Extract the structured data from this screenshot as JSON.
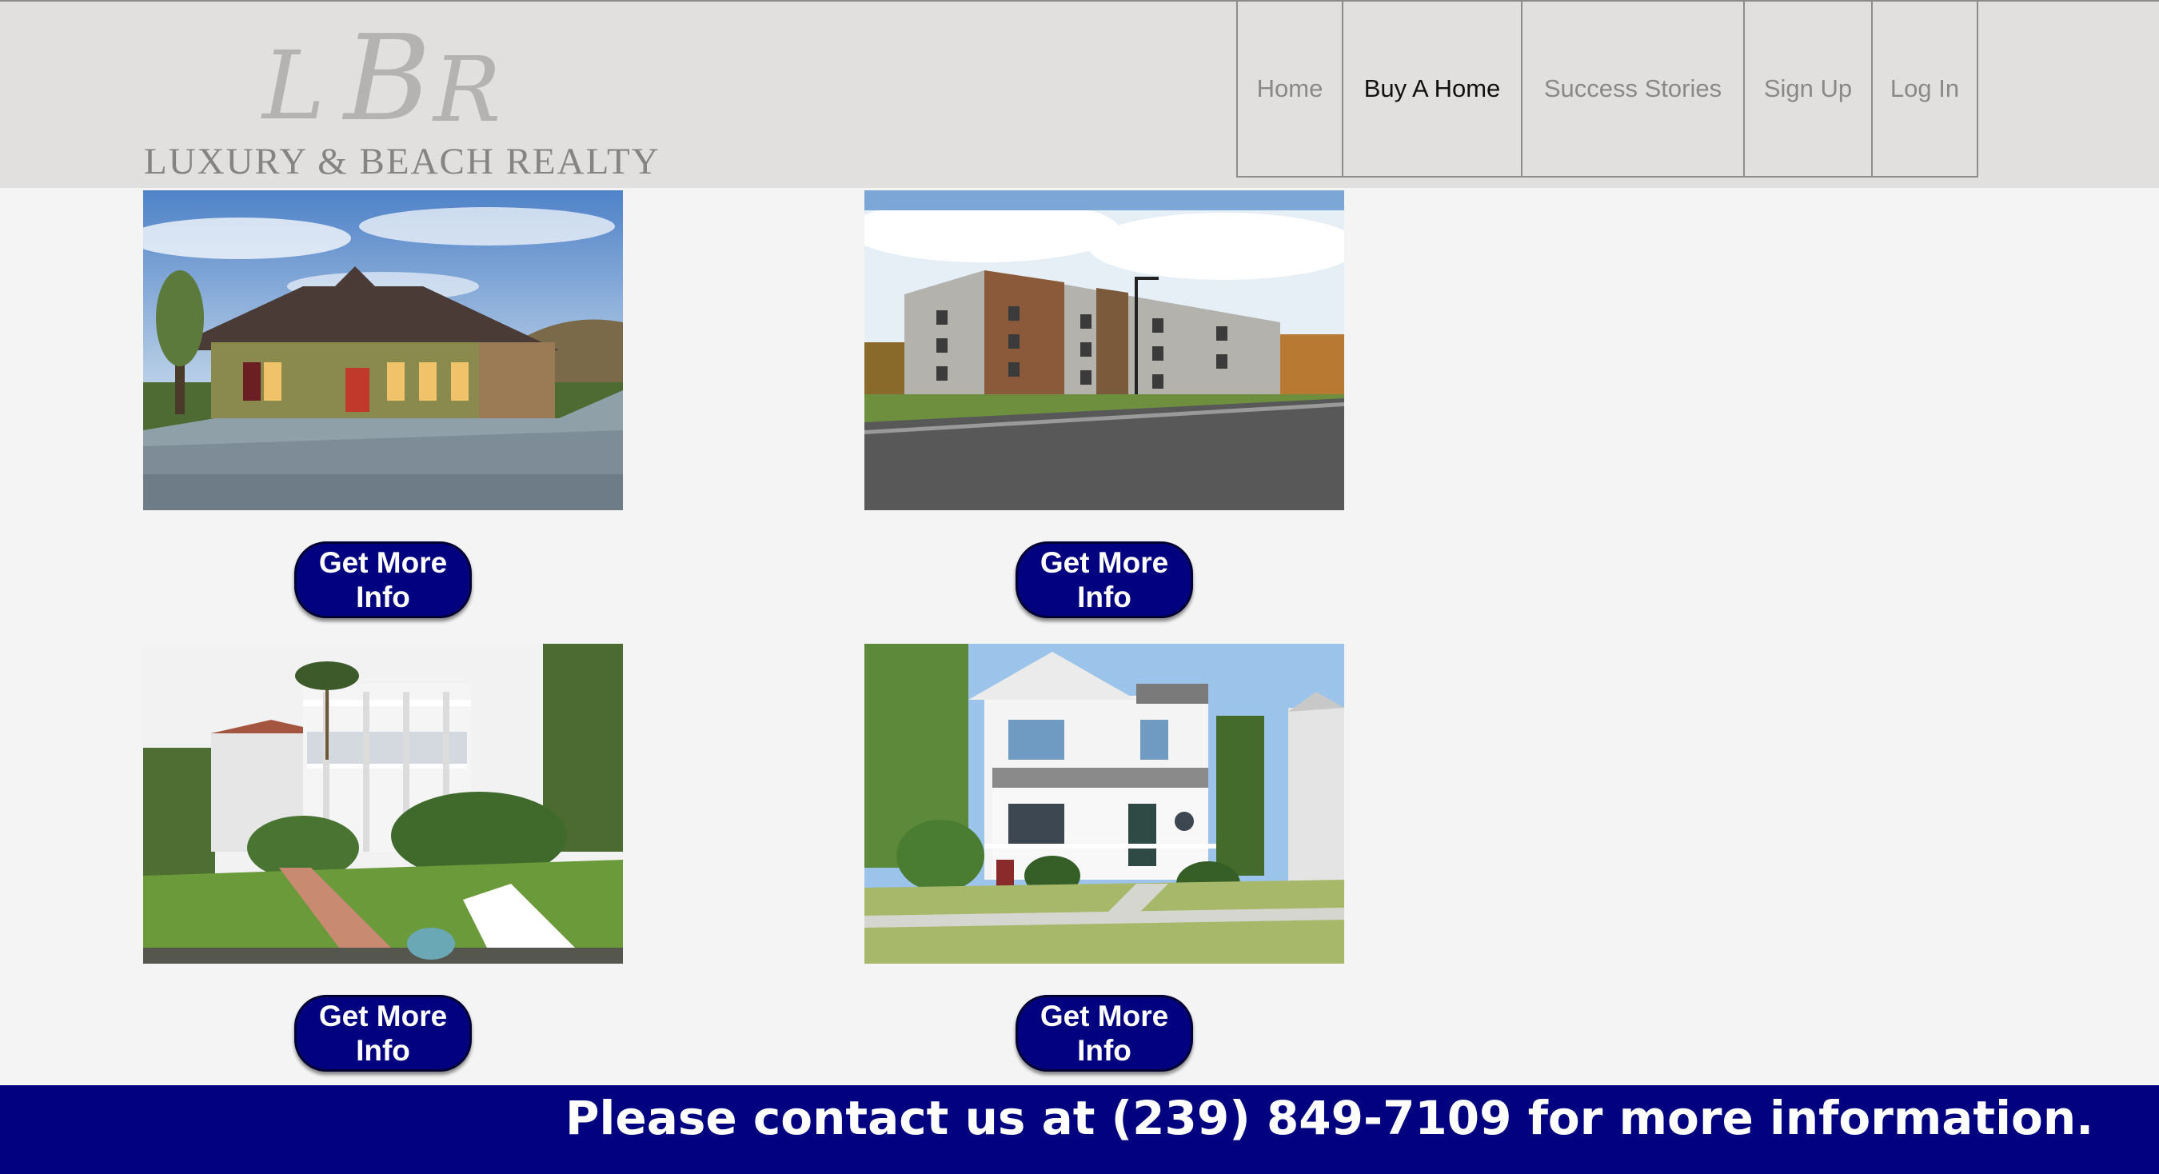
{
  "header": {
    "logo_monogram": "LBR",
    "logo_text": "LUXURY & BEACH REALTY"
  },
  "nav": {
    "items": [
      {
        "label": "Home"
      },
      {
        "label": "Buy A Home",
        "active": true
      },
      {
        "label": "Success Stories"
      },
      {
        "label": "Sign Up"
      },
      {
        "label": "Log In"
      }
    ]
  },
  "listings": [
    {
      "image": "stucco-house-photo",
      "button_label": "Get More Info"
    },
    {
      "image": "apartment-building-photo",
      "button_label": "Get More Info"
    },
    {
      "image": "white-beach-house-photo",
      "button_label": "Get More Info"
    },
    {
      "image": "white-two-story-house-photo",
      "button_label": "Get More Info"
    }
  ],
  "footer": {
    "text": "Please contact us at (239) 849-7109 for more information."
  },
  "colors": {
    "header_bg": "#e1e0df",
    "page_bg": "#f4f4f5",
    "accent_navy": "#02017f"
  }
}
